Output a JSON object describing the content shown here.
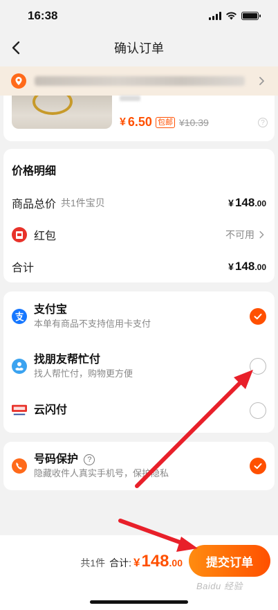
{
  "status_bar": {
    "time": "16:38"
  },
  "nav": {
    "title": "确认订单"
  },
  "product": {
    "currency": "¥",
    "price": "6.50",
    "badge": "包邮",
    "original_price": "¥10.39",
    "help_symbol": "?"
  },
  "price_detail": {
    "title": "价格明细",
    "goods_total_label": "商品总价",
    "goods_total_sub": "共1件宝贝",
    "goods_total_currency": "¥",
    "goods_total_int": "148",
    "goods_total_dec": ".00",
    "hongbao_label": "红包",
    "hongbao_value": "不可用",
    "subtotal_label": "合计",
    "subtotal_currency": "¥",
    "subtotal_int": "148",
    "subtotal_dec": ".00"
  },
  "payment": {
    "options": [
      {
        "name": "支付宝",
        "desc": "本单有商品不支持信用卡支付",
        "checked": true
      },
      {
        "name": "找朋友帮忙付",
        "desc": "找人帮忙付，购物更方便",
        "checked": false
      },
      {
        "name": "云闪付",
        "desc": "",
        "checked": false
      }
    ]
  },
  "protection": {
    "name": "号码保护",
    "desc": "隐藏收件人真实手机号，保护隐私",
    "help_symbol": "?",
    "checked": true
  },
  "bottom": {
    "count": "共1件",
    "total_label": "合计:",
    "currency": "¥",
    "total_int": "148",
    "total_dec": ".00",
    "submit_label": "提交订单"
  },
  "watermark": "Baidu 经验",
  "colors": {
    "accent": "#ff5000",
    "accent_light": "#ff8c10",
    "arrow": "#e8202a",
    "alipay": "#1677ff",
    "unionpay": "#e8322a"
  }
}
